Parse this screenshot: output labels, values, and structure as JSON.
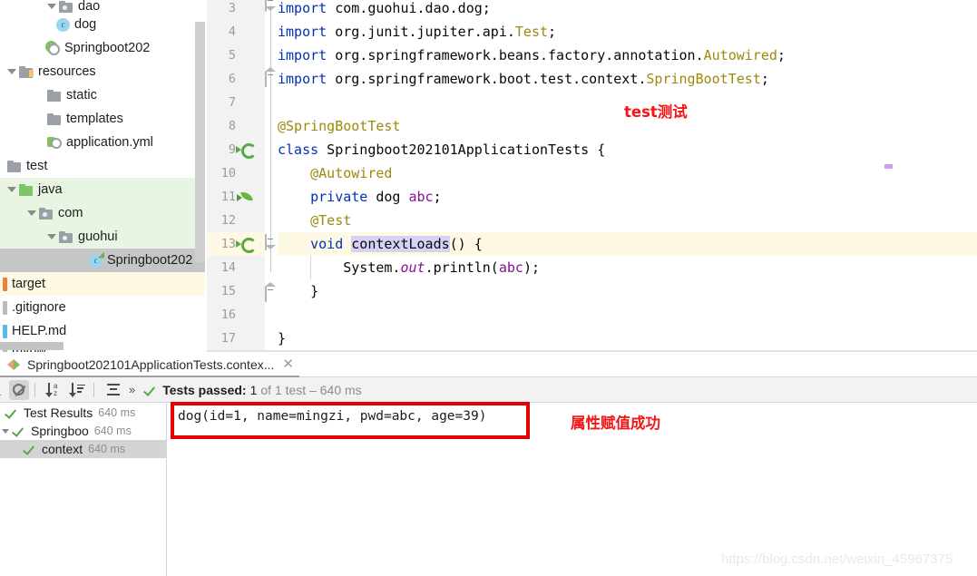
{
  "project_tree": {
    "items": [
      {
        "label": "dao",
        "indent": 3,
        "icon": "folder-package-icon",
        "caret": "down",
        "highlight": "none",
        "clipped_top": true
      },
      {
        "label": "dog",
        "indent": 4,
        "icon": "java-class-icon",
        "caret": "none",
        "highlight": "none"
      },
      {
        "label": "Springboot202",
        "indent": 3,
        "icon": "spring-boot-app-icon",
        "caret": "none",
        "highlight": "none"
      },
      {
        "label": "resources",
        "indent": 1,
        "icon": "resources-folder-icon",
        "caret": "down",
        "highlight": "none"
      },
      {
        "label": "static",
        "indent": 2,
        "icon": "folder-icon",
        "caret": "none",
        "highlight": "none"
      },
      {
        "label": "templates",
        "indent": 2,
        "icon": "folder-icon",
        "caret": "none",
        "highlight": "none"
      },
      {
        "label": "application.yml",
        "indent": 2,
        "icon": "yml-file-icon",
        "caret": "none",
        "highlight": "none"
      },
      {
        "label": "test",
        "indent": 0,
        "icon": "folder-icon",
        "caret": "none",
        "highlight": "none"
      },
      {
        "label": "java",
        "indent": 0,
        "icon": "source-folder-icon",
        "caret": "down",
        "highlight": "green"
      },
      {
        "label": "com",
        "indent": 1,
        "icon": "folder-package-icon",
        "caret": "down",
        "highlight": "green"
      },
      {
        "label": "guohui",
        "indent": 2,
        "icon": "folder-package-icon",
        "caret": "down",
        "highlight": "green"
      },
      {
        "label": "Springboot202",
        "indent": 3,
        "icon": "spring-test-class-icon",
        "caret": "none",
        "highlight": "selected"
      },
      {
        "label": "target",
        "indent": 0,
        "icon": "excluded-folder-bar",
        "caret": "none",
        "highlight": "yellow"
      },
      {
        "label": ".gitignore",
        "indent": 0,
        "icon": "git-file-bar",
        "caret": "none",
        "highlight": "none"
      },
      {
        "label": "HELP.md",
        "indent": 0,
        "icon": "markdown-file-bar",
        "caret": "none",
        "highlight": "none"
      },
      {
        "label": "mvnw",
        "indent": 0,
        "icon": "file-bar",
        "caret": "none",
        "highlight": "none"
      }
    ]
  },
  "editor": {
    "first_line_number": 3,
    "gutter_icons": {
      "8": "spring-bean-leaf-icon",
      "9": "run-test-class-icon",
      "11": "spring-autowired-bean-icon",
      "13": "run-test-method-icon"
    },
    "lines": [
      {
        "num": 3,
        "text": "import com.guohui.dao.dog;"
      },
      {
        "num": 4,
        "text": "import org.junit.jupiter.api.Test;"
      },
      {
        "num": 5,
        "text": "import org.springframework.beans.factory.annotation.Autowired;"
      },
      {
        "num": 6,
        "text": "import org.springframework.boot.test.context.SpringBootTest;"
      },
      {
        "num": 7,
        "text": ""
      },
      {
        "num": 8,
        "text": "@SpringBootTest"
      },
      {
        "num": 9,
        "text": "class Springboot202101ApplicationTests {"
      },
      {
        "num": 10,
        "text": "    @Autowired"
      },
      {
        "num": 11,
        "text": "    private dog abc;"
      },
      {
        "num": 12,
        "text": "    @Test"
      },
      {
        "num": 13,
        "text": "    void contextLoads() {"
      },
      {
        "num": 14,
        "text": "        System.out.println(abc);"
      },
      {
        "num": 15,
        "text": "    }"
      },
      {
        "num": 16,
        "text": ""
      },
      {
        "num": 17,
        "text": "}"
      }
    ],
    "caret_line": 13,
    "selected_token": "contextLoads"
  },
  "annotations": {
    "test_label": "test测试",
    "assign_label": "属性赋值成功",
    "color": "#f41616",
    "box_color": "#e40000"
  },
  "run_panel": {
    "tab_title": "Springboot202101ApplicationTests.contex...",
    "tab_close": "✕",
    "toolbar": {
      "suppress_label": "no-entry-icon",
      "sort_alpha_label": "sort-alphabetically-icon",
      "sort_duration_label": "sort-by-duration-icon",
      "expand_label": "expand-collapse-icon",
      "overflow_label": "»"
    },
    "status": {
      "prefix": "Tests passed:",
      "count": "1",
      "suffix": "of 1 test – 640 ms"
    },
    "tree": [
      {
        "label": "Test Results",
        "time": "640 ms",
        "caret": "none",
        "indent": 0,
        "selected": false
      },
      {
        "label": "Springboo",
        "time": "640 ms",
        "caret": "down",
        "indent": 0,
        "selected": false
      },
      {
        "label": "context",
        "time": "640 ms",
        "caret": "none",
        "indent": 1,
        "selected": true
      }
    ],
    "console_output": "dog(id=1, name=mingzi, pwd=abc, age=39)"
  },
  "watermark": "https://blog.csdn.net/weixin_45967375"
}
